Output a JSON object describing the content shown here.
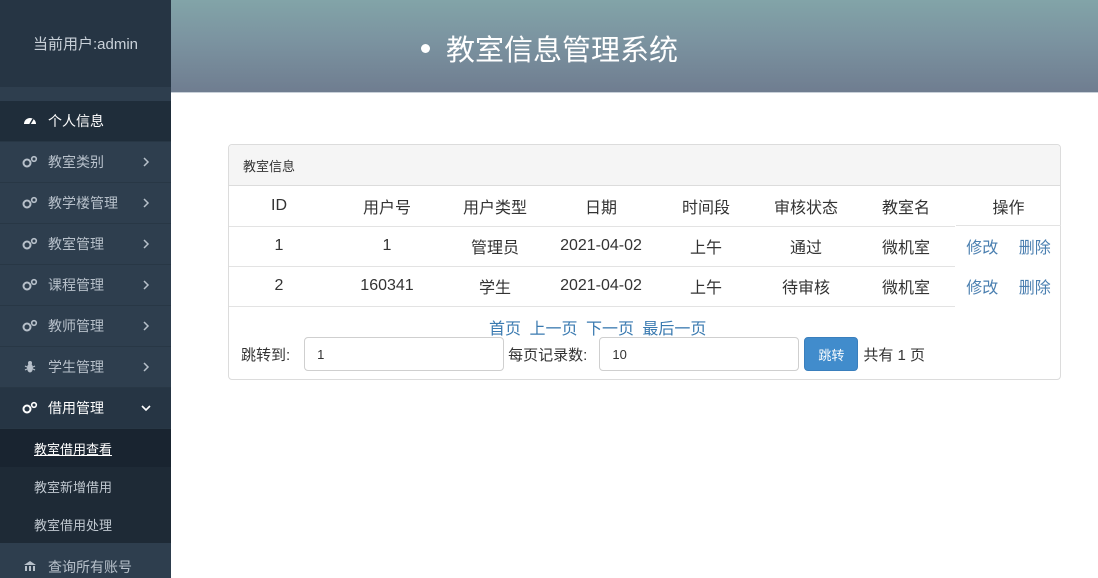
{
  "sidebar": {
    "current_user": "当前用户:admin",
    "items": [
      {
        "label": "个人信息",
        "icon": "dashboard-icon"
      },
      {
        "label": "教室类别",
        "icon": "gears-icon"
      },
      {
        "label": "教学楼管理",
        "icon": "gears-icon"
      },
      {
        "label": "教室管理",
        "icon": "gears-icon"
      },
      {
        "label": "课程管理",
        "icon": "gears-icon"
      },
      {
        "label": "教师管理",
        "icon": "gears-icon"
      },
      {
        "label": "学生管理",
        "icon": "bug-icon"
      },
      {
        "label": "借用管理",
        "icon": "gears-icon"
      }
    ],
    "submenu": [
      "教室借用查看",
      "教室新增借用",
      "教室借用处理"
    ],
    "last_item": "查询所有账号"
  },
  "header": {
    "title": "教室信息管理系统"
  },
  "panel": {
    "heading": "教室信息",
    "columns": [
      "ID",
      "用户号",
      "用户类型",
      "日期",
      "时间段",
      "审核状态",
      "教室名",
      "操作"
    ],
    "rows": [
      {
        "id": "1",
        "user_no": "1",
        "user_type": "管理员",
        "date": "2021-04-02",
        "period": "上午",
        "status": "通过",
        "room": "微机室"
      },
      {
        "id": "2",
        "user_no": "160341",
        "user_type": "学生",
        "date": "2021-04-02",
        "period": "上午",
        "status": "待审核",
        "room": "微机室"
      }
    ],
    "edit_label": "修改",
    "delete_label": "删除"
  },
  "pager": {
    "first": "首页",
    "prev": "上一页",
    "next": "下一页",
    "last": "最后一页",
    "jump_label": "跳转到:",
    "jump_value": "1",
    "per_page_label": "每页记录数:",
    "per_page_value": "10",
    "jump_button": "跳转",
    "total": "共有 1 页"
  },
  "colors": {
    "sidebar": "#2e3e4e",
    "accent": "#418ccc",
    "link": "#4a7fb0"
  }
}
